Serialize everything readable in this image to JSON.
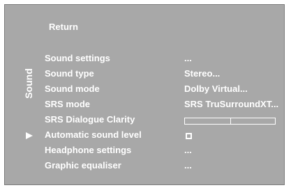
{
  "header": {
    "title": "Return"
  },
  "side": {
    "label": "Sound"
  },
  "menu": {
    "items": [
      {
        "label": "Sound settings",
        "value": "..."
      },
      {
        "label": "Sound type",
        "value": "Stereo..."
      },
      {
        "label": "Sound mode",
        "value": "Dolby Virtual..."
      },
      {
        "label": "SRS mode",
        "value": "SRS TruSurroundXT..."
      },
      {
        "label": "SRS Dialogue Clarity",
        "value": ""
      },
      {
        "label": "Automatic sound level",
        "value": ""
      },
      {
        "label": "Headphone settings",
        "value": "..."
      },
      {
        "label": "Graphic equaliser",
        "value": "..."
      }
    ],
    "selected_item": "Automatic sound level",
    "srs_dialogue_clarity_level": 0.5,
    "automatic_sound_level_checked": false
  }
}
